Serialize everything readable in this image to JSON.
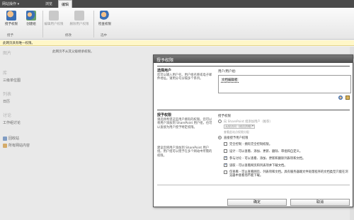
{
  "topbar": {
    "site_actions": "网站操作 ▾",
    "tabs": [
      "浏览",
      "编辑"
    ],
    "active_tab": "编辑"
  },
  "ribbon": {
    "buttons": [
      {
        "label": "授予权限",
        "icon": "grant-permissions-icon"
      },
      {
        "label": "创建组",
        "icon": "create-group-icon"
      },
      {
        "label": "编辑用户权限",
        "icon": "edit-permissions-icon"
      },
      {
        "label": "删除用户权限",
        "icon": "remove-permissions-icon"
      },
      {
        "label": "检查权限",
        "icon": "check-permissions-icon"
      }
    ],
    "groups": [
      "授予",
      "修改",
      "选中"
    ]
  },
  "warning": "此网页具有唯一权限。",
  "leftnav": {
    "sections": [
      {
        "heading": "图片",
        "items": []
      },
      {
        "heading": "库",
        "items": [
          "三级单位图"
        ]
      },
      {
        "heading": "列表",
        "items": [
          "日历"
        ]
      },
      {
        "heading": "讨论",
        "items": [
          "工作组讨论"
        ]
      }
    ],
    "bottom_items": [
      "回收站",
      "所有网站内容"
    ]
  },
  "main_heading": "此网页不从其父级继承权限。",
  "dialog": {
    "title": "授予权限",
    "select_users": {
      "title": "选择用户",
      "description": "您可以输入用户名、用户组名称或电子邮件地址。请用分号分隔多个条目。",
      "field_label": "用户/用户组:",
      "entered_user": "文档编辑者"
    },
    "grant": {
      "title": "授予权限",
      "description": "请选择希望这些用户拥有的权限。您可以将用户添加到 SharePoint 用户组，也可以直接为用户授予特定权限。",
      "description2": "建议您将用户添加到 SharePoint 用户组。用户组可以授予在多个网站中所需的权限。",
      "field_label": "授予权限",
      "option_group": "向 SharePoint 组添加用户（推荐）",
      "group_select": "无权访问（成员资格）",
      "group_hint": "查看此站点权限分配",
      "option_direct": "直接授予用户权限",
      "permissions": [
        {
          "label": "完全控制 - 拥有完全控制权限。",
          "checked": false
        },
        {
          "label": "设计 - 可以查看、添加、更新、删除、审批和自定义。",
          "checked": false
        },
        {
          "label": "参与讨论 - 可以查看、添加、更新和删除列表项和文档。",
          "checked": true
        },
        {
          "label": "读取 - 可以查看网页和列表项并下载文档。",
          "checked": true
        },
        {
          "label": "仅查看 - 可以查看网页、列表项和文档。具有服务器端文件处理程序的文档类型只能在浏览器中查看而不能下载。",
          "checked": false
        }
      ]
    },
    "ok": "确定",
    "cancel": "取消"
  },
  "colors": {
    "topbar": "#4a4a4a",
    "dialog_title": "#5e5e5e",
    "warning_bg": "#fff7c8"
  }
}
